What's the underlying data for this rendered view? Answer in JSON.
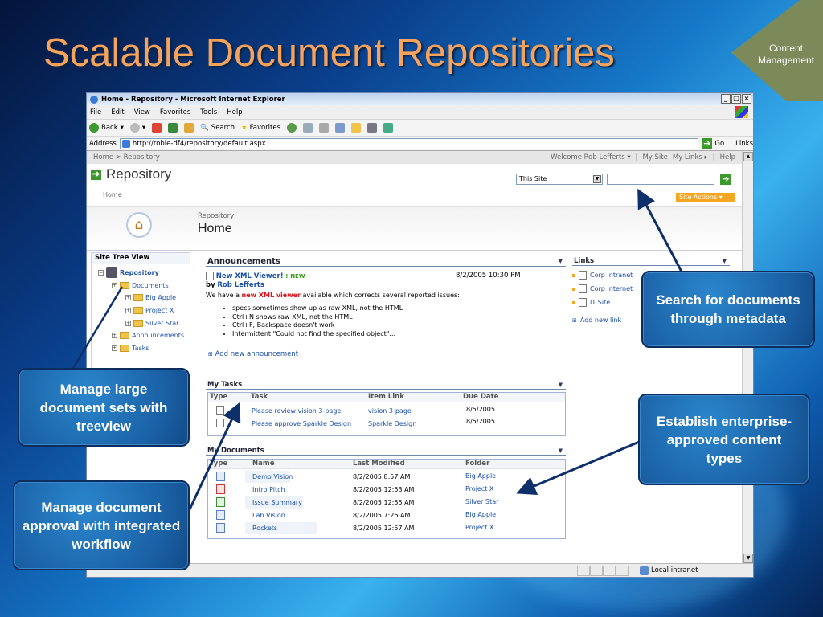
{
  "slide": {
    "title": "Scalable Document Repositories",
    "badge": "Content Management"
  },
  "browser": {
    "title": "Home - Repository - Microsoft Internet Explorer",
    "menu": [
      "File",
      "Edit",
      "View",
      "Favorites",
      "Tools",
      "Help"
    ],
    "toolbar": {
      "back": "Back",
      "search": "Search",
      "favorites": "Favorites"
    },
    "address_label": "Address",
    "address_value": "http://roble-df4/repository/default.aspx",
    "go_label": "Go",
    "links_label": "Links",
    "status_zone": "Local intranet"
  },
  "site": {
    "breadcrumb": "Home > Repository",
    "welcome": "Welcome Rob Lefferts ▾",
    "my_site": "My Site",
    "my_links": "My Links ▸",
    "help": "Help",
    "title": "Repository",
    "home_link": "Home",
    "search_scope": "This Site",
    "site_actions": "Site Actions ▾",
    "crumb_small": "Repository",
    "crumb_big": "Home"
  },
  "tree": {
    "title": "Site Tree View",
    "root": "Repository",
    "nodes": [
      "Documents",
      "Big Apple",
      "Project X",
      "Silver Star",
      "Announcements",
      "Tasks"
    ]
  },
  "announcements": {
    "title": "Announcements",
    "item_title": "New XML Viewer!",
    "new_tag": "NEW",
    "date": "8/2/2005 10:30 PM",
    "by_label": "by",
    "author": "Rob Lefferts",
    "body_pre": "We have a",
    "body_highlight": "new XML viewer",
    "body_post": "available which corrects several reported issues:",
    "issues": [
      "specs sometimes show up as raw XML, not the HTML",
      "Ctrl+N shows raw XML, not the HTML",
      "Ctrl+F, Backspace doesn't work",
      "Intermittent \"Could not find the specified object\"..."
    ],
    "add_label": "Add new announcement"
  },
  "tasks": {
    "title": "My Tasks",
    "columns": [
      "Type",
      "Task",
      "Item Link",
      "Due Date"
    ],
    "rows": [
      {
        "task": "Please review vision 3-page",
        "link": "vision 3-page",
        "due": "8/5/2005"
      },
      {
        "task": "Please approve Sparkle Design",
        "link": "Sparkle Design",
        "due": "8/5/2005"
      }
    ]
  },
  "documents": {
    "title": "My Documents",
    "columns": [
      "Type",
      "Name",
      "Last Modified",
      "Folder"
    ],
    "rows": [
      {
        "name": "Demo Vision",
        "modified": "8/2/2005 8:57 AM",
        "folder": "Big Apple"
      },
      {
        "name": "Intro Pitch",
        "modified": "8/2/2005 12:53 AM",
        "folder": "Project X"
      },
      {
        "name": "Issue Summary",
        "modified": "8/2/2005 12:55 AM",
        "folder": "Silver Star"
      },
      {
        "name": "Lab Vision",
        "modified": "8/2/2005 7:26 AM",
        "folder": "Big Apple"
      },
      {
        "name": "Rockets",
        "modified": "8/2/2005 12:57 AM",
        "folder": "Project X"
      }
    ]
  },
  "links": {
    "title": "Links",
    "items": [
      "Corp Intranet",
      "Corp Internet",
      "IT Site"
    ],
    "add_label": "Add new link"
  },
  "callouts": {
    "search": "Search for documents through metadata",
    "content_types": "Establish enterprise-approved content types",
    "treeview": "Manage large document sets with treeview",
    "workflow": "Manage document approval with integrated workflow"
  }
}
